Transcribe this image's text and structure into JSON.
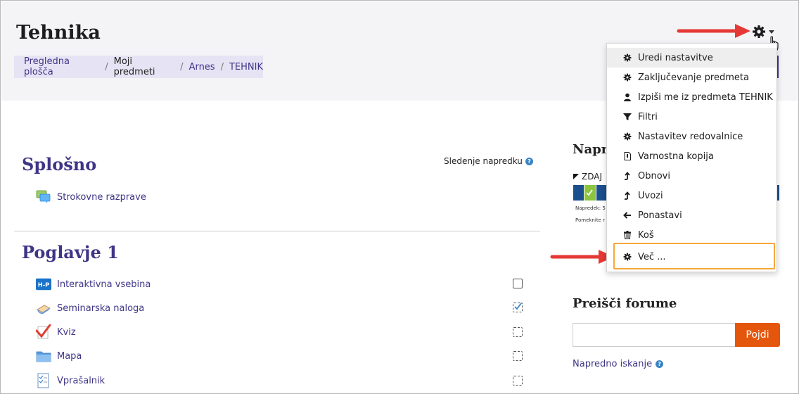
{
  "header": {
    "title": "Tehnika",
    "breadcrumb": [
      "Pregledna plošča",
      "Moji predmeti",
      "Arnes",
      "TEHNIK"
    ]
  },
  "menu": {
    "items": [
      {
        "label": "Uredi nastavitve",
        "icon": "gear-icon"
      },
      {
        "label": "Zaključevanje predmeta",
        "icon": "gear-icon"
      },
      {
        "label": "Izpiši me iz predmeta TEHNIK",
        "icon": "user-icon"
      },
      {
        "label": "Filtri",
        "icon": "filter-icon"
      },
      {
        "label": "Nastavitev redovalnice",
        "icon": "gear-icon"
      },
      {
        "label": "Varnostna kopija",
        "icon": "file-icon"
      },
      {
        "label": "Obnovi",
        "icon": "upload-icon"
      },
      {
        "label": "Uvozi",
        "icon": "upload-icon"
      },
      {
        "label": "Ponastavi",
        "icon": "arrow-left-icon"
      },
      {
        "label": "Koš",
        "icon": "trash-icon"
      },
      {
        "label": "Več ...",
        "icon": "gear-icon"
      }
    ]
  },
  "sections": {
    "general": {
      "title": "Splošno",
      "progress_label": "Sledenje napredku",
      "activities": [
        {
          "label": "Strokovne razprave",
          "icon": "forum-icon"
        }
      ]
    },
    "chapter1": {
      "title": "Poglavje 1",
      "activities": [
        {
          "label": "Interaktivna vsebina",
          "icon": "h5p-icon",
          "completion": "empty"
        },
        {
          "label": "Seminarska naloga",
          "icon": "assignment-icon",
          "completion": "done"
        },
        {
          "label": "Kviz",
          "icon": "quiz-icon",
          "completion": "dashed"
        },
        {
          "label": "Mapa",
          "icon": "folder-icon",
          "completion": "dashed"
        },
        {
          "label": "Vprašalnik",
          "icon": "questionnaire-icon",
          "completion": "dashed"
        }
      ]
    }
  },
  "progress_block": {
    "title": "Napre",
    "now_label": "ZDAJ",
    "tiny1": "Napredek: 5",
    "tiny2": "Pomeknite r"
  },
  "forum_search": {
    "title": "Preišči forume",
    "button": "Pojdi",
    "advanced": "Napredno iskanje"
  },
  "colors": {
    "accent": "#3f3587",
    "button": "#e5560d",
    "highlight_box": "#f3a83b",
    "arrow": "#e53935"
  }
}
